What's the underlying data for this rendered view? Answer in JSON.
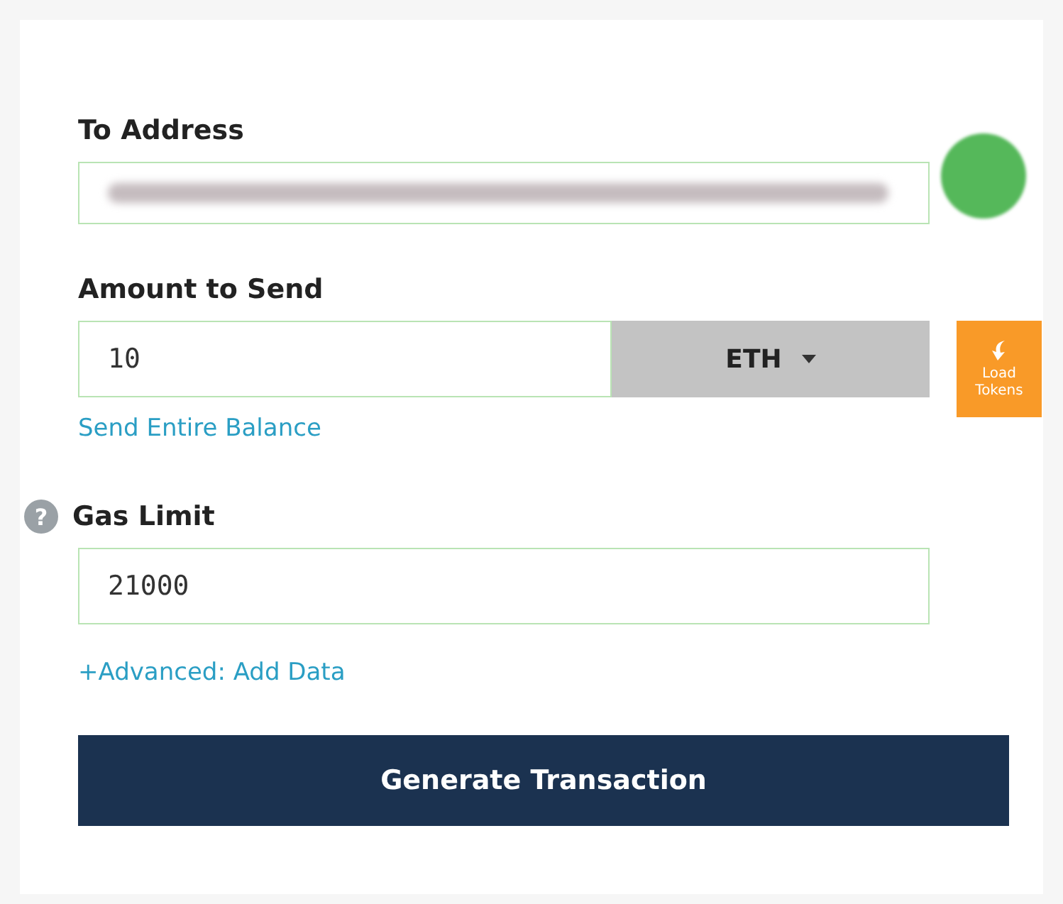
{
  "to_address": {
    "label": "To Address"
  },
  "amount": {
    "label": "Amount to Send",
    "value": "10",
    "currency": "ETH",
    "load_tokens": "Load Tokens",
    "send_entire_balance": "Send Entire Balance"
  },
  "gas_limit": {
    "label": "Gas Limit",
    "help": "?",
    "value": "21000",
    "advanced_link": "+Advanced: Add Data"
  },
  "generate_button": "Generate Transaction"
}
